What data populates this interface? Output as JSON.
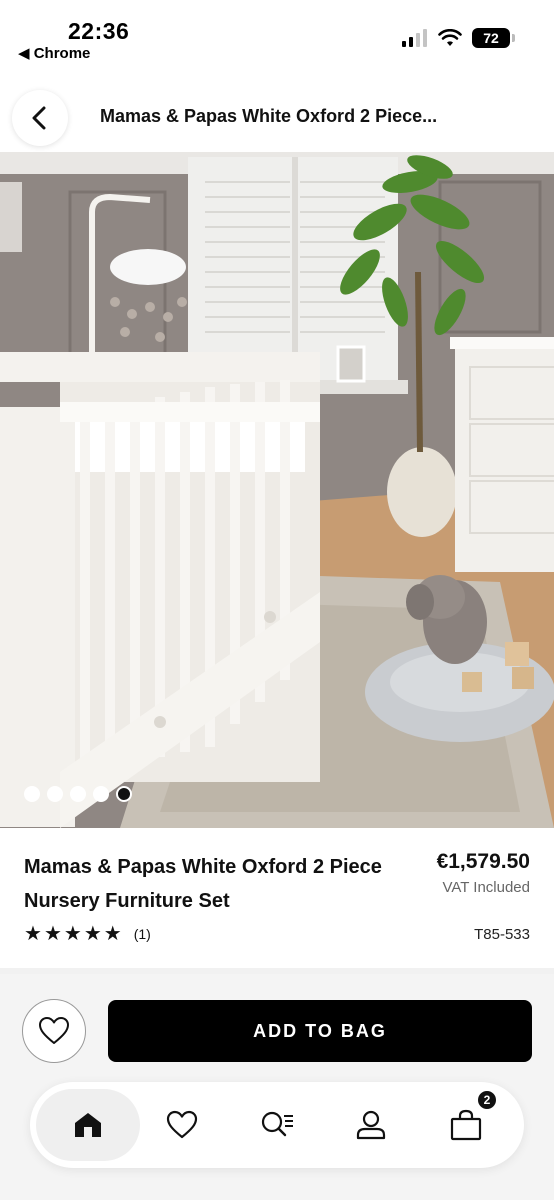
{
  "status_bar": {
    "time": "22:36",
    "back_app": "◀ Chrome",
    "battery": "72",
    "icons": [
      "cellular-signal-icon",
      "wifi-icon",
      "battery-icon"
    ]
  },
  "header": {
    "title": "Mamas & Papas White Oxford 2 Piece...",
    "back_icon": "chevron-left-icon"
  },
  "gallery": {
    "image_count": 5,
    "active_index": 4
  },
  "product": {
    "name_line1": "Mamas & Papas White Oxford 2 Piece",
    "name_line2": "Nursery Furniture Set",
    "price": "€1,579.50",
    "vat_note": "VAT Included",
    "rating": 5,
    "stars": [
      "★",
      "★",
      "★",
      "★",
      "★"
    ],
    "review_count": "(1)",
    "sku": "T85-533"
  },
  "actions": {
    "wishlist_icon": "heart-icon",
    "add_to_bag": "ADD TO BAG"
  },
  "tabbar": {
    "items": [
      {
        "name": "home",
        "icon": "home-icon",
        "active": true
      },
      {
        "name": "wishlist",
        "icon": "heart-icon",
        "active": false
      },
      {
        "name": "search",
        "icon": "search-list-icon",
        "active": false
      },
      {
        "name": "account",
        "icon": "user-icon",
        "active": false
      },
      {
        "name": "bag",
        "icon": "shopping-bag-icon",
        "active": false
      }
    ],
    "bag_badge": "2"
  },
  "colors": {
    "primary": "#000000",
    "background": "#ffffff",
    "footer_bg": "#f4f4f4",
    "muted_text": "#666666"
  }
}
